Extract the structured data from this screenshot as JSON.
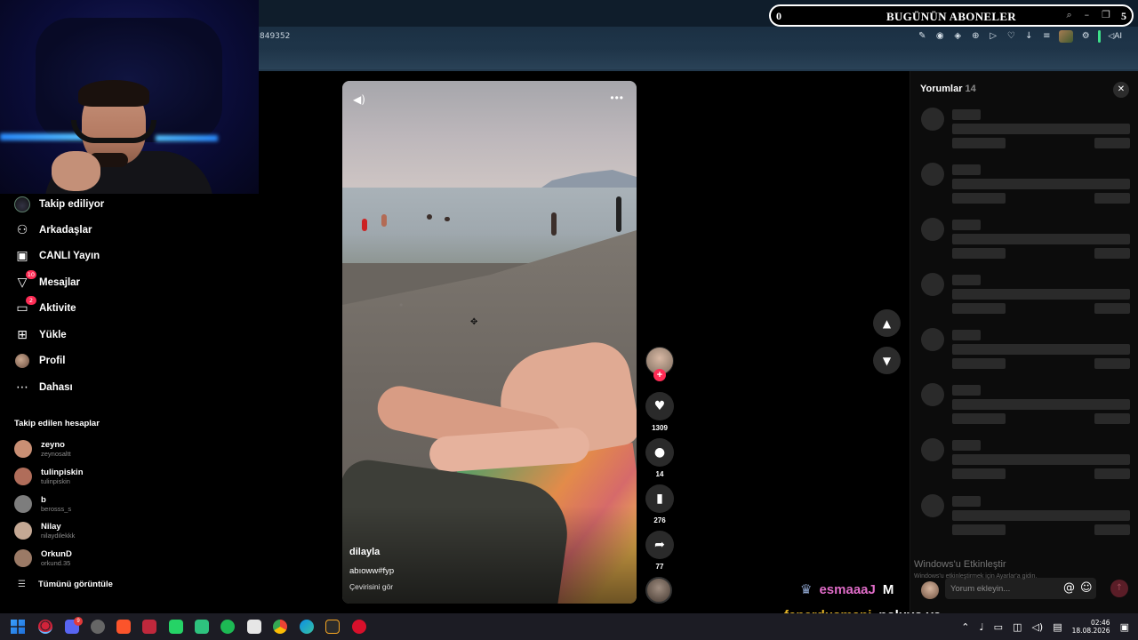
{
  "browser": {
    "address_fragment": "849352",
    "toolbar_ai_label": "AI"
  },
  "subscriber_overlay": {
    "left_count": "0",
    "title": "BUGÜNÜN ABONELER",
    "right_count": "5"
  },
  "sidebar": {
    "items": [
      {
        "label": "Takip ediliyor",
        "icon": "following-icon",
        "badge": ""
      },
      {
        "label": "Arkadaşlar",
        "icon": "friends-icon",
        "badge": ""
      },
      {
        "label": "CANLI Yayın",
        "icon": "live-icon",
        "badge": ""
      },
      {
        "label": "Mesajlar",
        "icon": "messages-icon",
        "badge": "10"
      },
      {
        "label": "Aktivite",
        "icon": "activity-icon",
        "badge": "2"
      },
      {
        "label": "Yükle",
        "icon": "upload-icon",
        "badge": ""
      },
      {
        "label": "Profil",
        "icon": "profile-icon",
        "badge": ""
      },
      {
        "label": "Dahası",
        "icon": "more-icon",
        "badge": ""
      }
    ],
    "following_title": "Takip edilen hesaplar",
    "accounts": [
      {
        "name": "zeyno",
        "handle": "zeynosaltt",
        "color": "#c98f74"
      },
      {
        "name": "tulinpiskin",
        "handle": "tulinpiskin",
        "color": "#b06d5a"
      },
      {
        "name": "b",
        "handle": "berosss_s",
        "color": "#7d7d7d"
      },
      {
        "name": "Nilay",
        "handle": "nilaydilekkk",
        "color": "#c4a894"
      },
      {
        "name": "OrkunD",
        "handle": "orkund.35",
        "color": "#9b7a66"
      }
    ],
    "see_all": "Tümünü görüntüle"
  },
  "video": {
    "author": "dilayla",
    "caption": "abıoww#fyp",
    "translate": "Çevirisini gör",
    "likes": "1309",
    "comments": "14",
    "saves": "276",
    "shares": "77"
  },
  "comments_panel": {
    "title": "Yorumlar",
    "count": "14",
    "input_placeholder": "Yorum ekleyin..."
  },
  "watermark": {
    "title": "Windows'u Etkinleştir",
    "subtitle": "Windows'u etkinleştirmek için Ayarlar'a gidin."
  },
  "chat": [
    {
      "user": "esmaaaJ",
      "message": "M"
    },
    {
      "user": "fenerdusmani",
      "message": "noluyo ya"
    }
  ],
  "taskbar": {
    "time": "02:46",
    "date": "18.08.2026",
    "discord_badge": "9"
  },
  "colors": {
    "tiktok_red": "#fe2c55",
    "chat_user1": "#e06cc8",
    "chat_user2": "#e8b82a"
  }
}
